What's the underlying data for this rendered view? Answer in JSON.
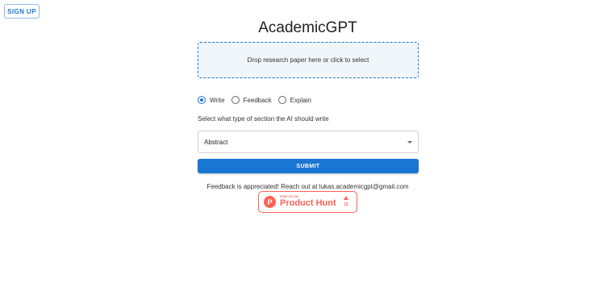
{
  "header": {
    "signup_label": "SIGN UP"
  },
  "app": {
    "title": "AcademicGPT"
  },
  "dropzone": {
    "text": "Drop research paper here or click to select"
  },
  "mode": {
    "options": [
      "Write",
      "Feedback",
      "Explain"
    ],
    "selected": "Write"
  },
  "section": {
    "prompt": "Select what type of section the AI should write",
    "selected_value": "Abstract"
  },
  "submit": {
    "label": "SUBMIT"
  },
  "footer": {
    "feedback_text": "Feedback is appreciated! Reach out at lukas.academicgpt@gmail.com"
  },
  "product_hunt": {
    "small_text": "FIND US ON",
    "big_text": "Product Hunt",
    "logo_letter": "P",
    "votes": "11",
    "color": "#ff6154"
  },
  "colors": {
    "primary": "#1976d2"
  }
}
